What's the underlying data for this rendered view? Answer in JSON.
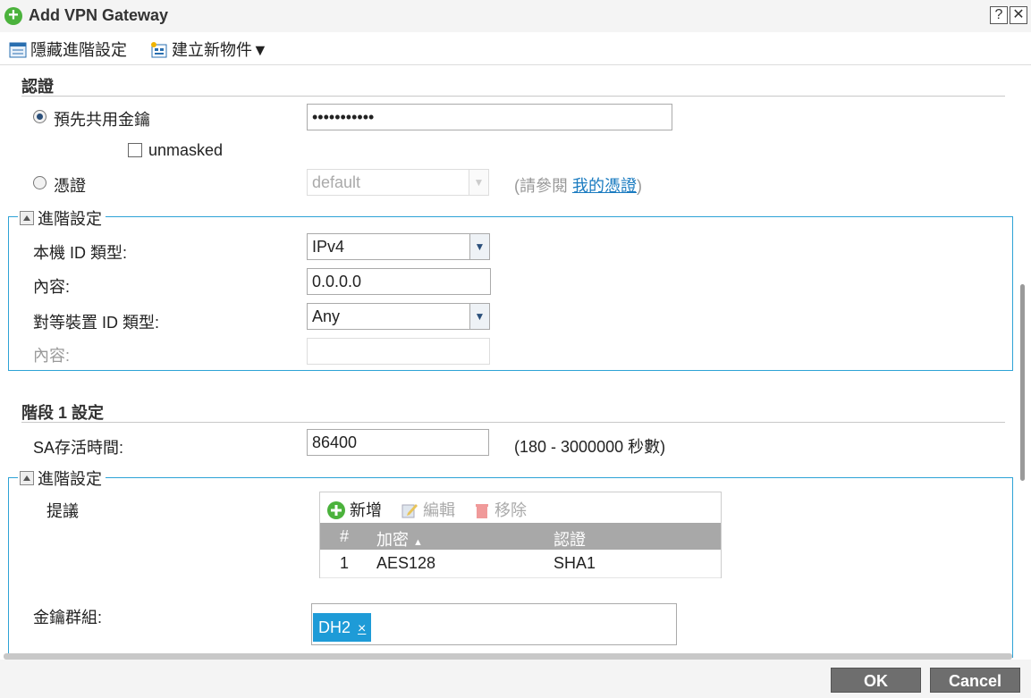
{
  "window": {
    "title": "Add VPN Gateway",
    "help_label": "?",
    "close_label": "✕"
  },
  "toolbar": {
    "hide_advanced": "隱藏進階設定",
    "create_object": "建立新物件▼"
  },
  "auth": {
    "heading": "認證",
    "psk_label": "預先共用金鑰",
    "psk_value": "•••••••••••",
    "unmasked_label": "unmasked",
    "cert_label": "憑證",
    "cert_value": "default",
    "see_prefix": "(請參閱 ",
    "see_link": "我的憑證",
    "see_suffix": ")"
  },
  "adv1": {
    "legend": "進階設定",
    "local_id_type_label": "本機 ID 類型:",
    "local_id_type_value": "IPv4",
    "content_label": "內容:",
    "content_value": "0.0.0.0",
    "peer_id_type_label": "對等裝置 ID 類型:",
    "peer_id_type_value": "Any",
    "peer_content_label": "內容:",
    "peer_content_value": ""
  },
  "phase1": {
    "heading": "階段 1 設定",
    "sa_label": "SA存活時間:",
    "sa_value": "86400",
    "sa_range": "(180 - 3000000 秒數)"
  },
  "adv2": {
    "legend": "進階設定",
    "proposal_label": "提議",
    "add_label": "新增",
    "edit_label": "編輯",
    "remove_label": "移除",
    "columns": {
      "num": "#",
      "encryption": "加密",
      "auth": "認證"
    },
    "rows": [
      {
        "num": "1",
        "encryption": "AES128",
        "auth": "SHA1"
      }
    ],
    "key_group_label": "金鑰群組:",
    "key_group_chip": "DH2",
    "chip_remove": "×"
  },
  "footer": {
    "ok_label": "OK",
    "cancel_label": "Cancel"
  },
  "colors": {
    "accent": "#2ea3d6",
    "chip": "#1e9bd7",
    "add_green": "#4bb23c",
    "button_gray": "#6e6e6e"
  }
}
